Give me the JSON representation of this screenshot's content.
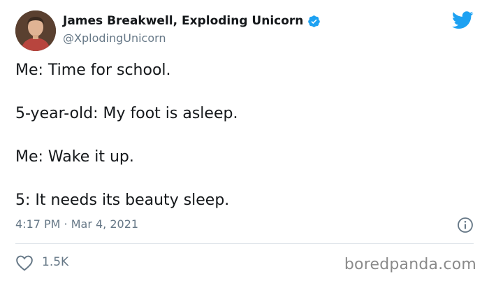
{
  "author": {
    "display_name": "James Breakwell, Exploding Unicorn",
    "handle": "@XplodingUnicorn",
    "verified": true
  },
  "tweet": {
    "lines": [
      "Me: Time for school.",
      "5-year-old: My foot is asleep.",
      "Me: Wake it up.",
      "5: It needs its beauty sleep."
    ],
    "timestamp": "4:17 PM · Mar 4, 2021"
  },
  "actions": {
    "likes": "1.5K"
  },
  "watermark": "boredpanda.com",
  "colors": {
    "twitter_blue": "#1da1f2",
    "text": "#14171a",
    "muted": "#657786"
  },
  "icons": {
    "logo": "twitter-bird-icon",
    "verified": "verified-badge-icon",
    "info": "info-icon",
    "like": "heart-icon"
  }
}
